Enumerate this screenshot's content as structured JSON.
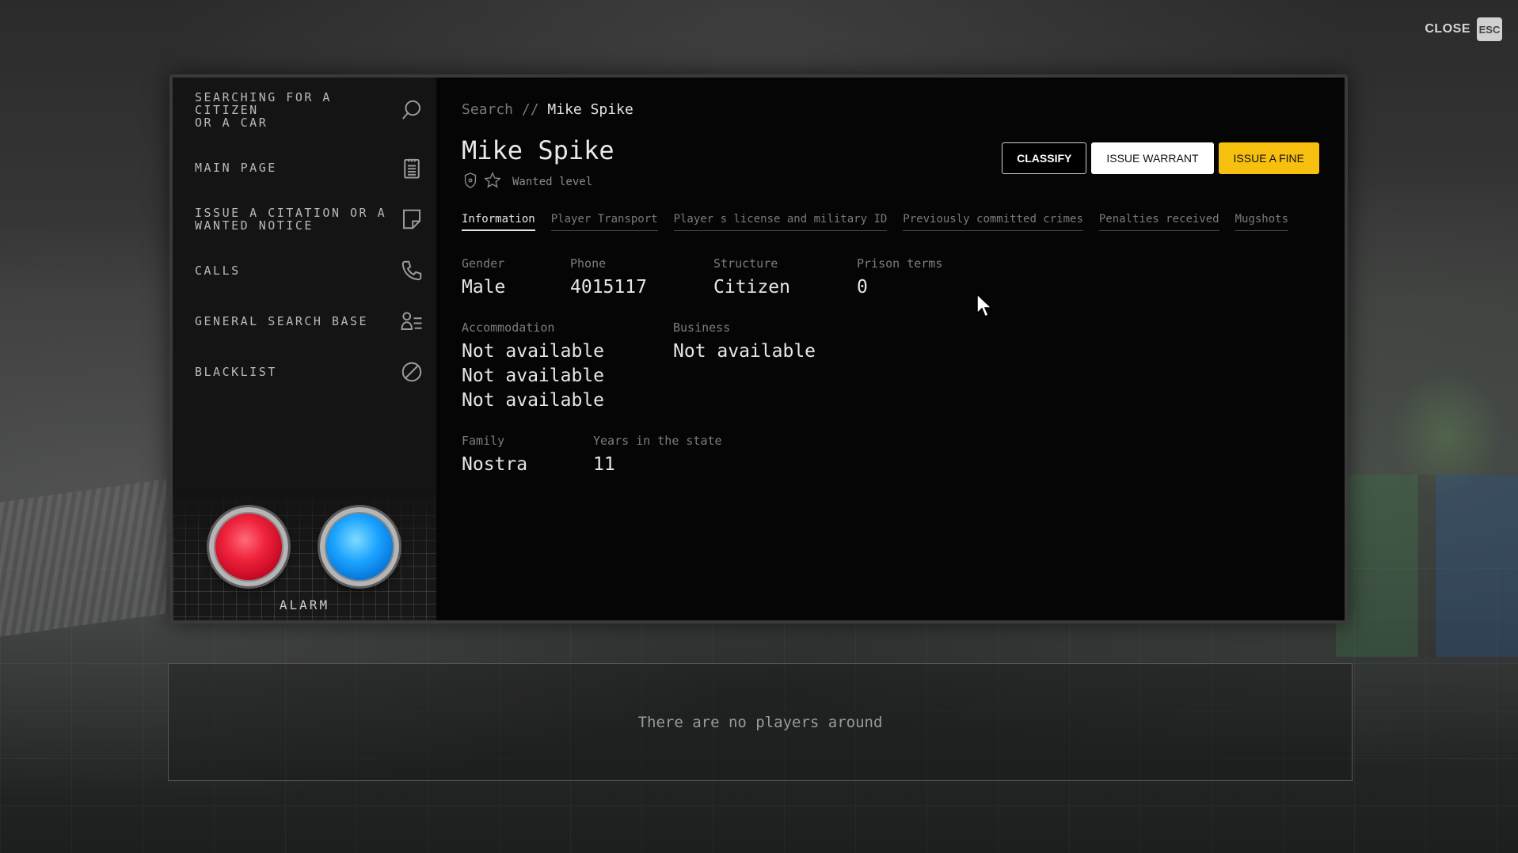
{
  "close": {
    "label": "CLOSE",
    "key": "ESC"
  },
  "sidebar": {
    "items": [
      {
        "label": "SEARCHING FOR A\nCITIZEN\nOR A CAR",
        "icon": "search-icon"
      },
      {
        "label": "MAIN PAGE",
        "icon": "clipboard-icon"
      },
      {
        "label": "ISSUE A CITATION OR A\nWANTED NOTICE",
        "icon": "note-icon"
      },
      {
        "label": "CALLS",
        "icon": "phone-icon"
      },
      {
        "label": "GENERAL SEARCH BASE",
        "icon": "user-list-icon"
      },
      {
        "label": "BLACKLIST",
        "icon": "ban-icon"
      }
    ],
    "alarm_label": "ALARM"
  },
  "breadcrumb": {
    "root": "Search",
    "separator": "//",
    "current": "Mike Spike"
  },
  "profile": {
    "name": "Mike Spike",
    "wanted_label": "Wanted level",
    "wanted_level": 0
  },
  "actions": {
    "classify": "CLASSIFY",
    "warrant": "ISSUE WARRANT",
    "fine": "ISSUE A FINE"
  },
  "tabs": [
    {
      "label": "Information",
      "active": true
    },
    {
      "label": "Player Transport",
      "active": false
    },
    {
      "label": "Player s license and military ID",
      "active": false
    },
    {
      "label": "Previously committed crimes",
      "active": false
    },
    {
      "label": "Penalties received",
      "active": false
    },
    {
      "label": "Mugshots",
      "active": false
    }
  ],
  "info": {
    "gender": {
      "label": "Gender",
      "value": "Male"
    },
    "phone": {
      "label": "Phone",
      "value": "4015117"
    },
    "structure": {
      "label": "Structure",
      "value": "Citizen"
    },
    "prison": {
      "label": "Prison terms",
      "value": "0"
    },
    "accommodation": {
      "label": "Accommodation",
      "values": [
        "Not available",
        "Not available",
        "Not available"
      ]
    },
    "business": {
      "label": "Business",
      "value": "Not available"
    },
    "family": {
      "label": "Family",
      "value": "Nostra"
    },
    "years": {
      "label": "Years in the state",
      "value": "11"
    }
  },
  "players": {
    "empty_text": "There are no players around"
  },
  "colors": {
    "accent": "#f7c00f",
    "alarm_red": "#f0243d",
    "alarm_blue": "#1aa2ff"
  }
}
